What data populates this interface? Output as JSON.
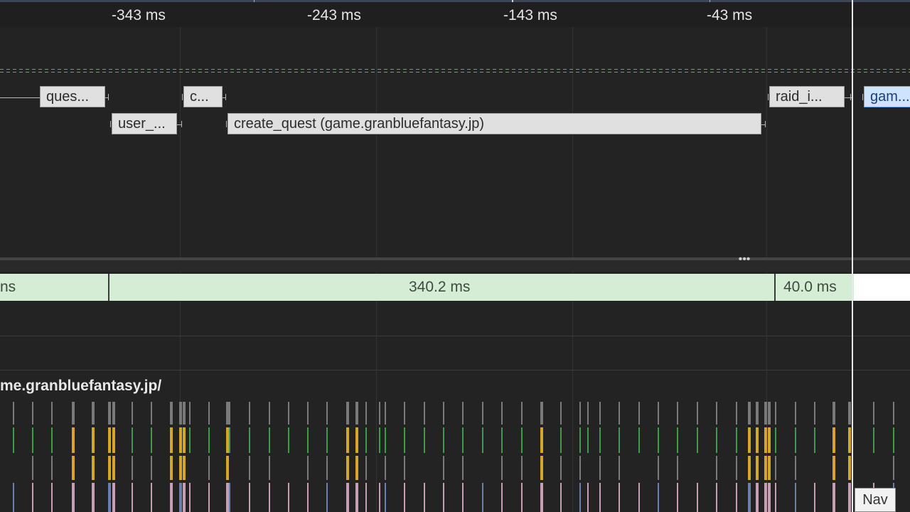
{
  "ruler": {
    "ticks": [
      "-343 ms",
      "-243 ms",
      "-143 ms",
      "-43 ms"
    ]
  },
  "network": {
    "requests": [
      {
        "label": "ques...",
        "selected": false
      },
      {
        "label": "user_...",
        "selected": false
      },
      {
        "label": "c...",
        "selected": false
      },
      {
        "label": "create_quest (game.granbluefantasy.jp)",
        "selected": false
      },
      {
        "label": "raid_i...",
        "selected": false
      },
      {
        "label": "gam...",
        "selected": true
      }
    ]
  },
  "frames": {
    "labels": [
      "ns",
      "340.2 ms",
      "40.0 ms"
    ]
  },
  "main": {
    "url": "me.granbluefantasy.jp/"
  },
  "nav_marker": {
    "label": "Nav"
  },
  "colors": {
    "background": "#232323",
    "frame_fill": "#d4edd4",
    "request_fill": "#e0e0e0",
    "selected_request_fill": "#cfe3ff",
    "network_dash": "#b06ad8",
    "scripting": "#d6a62a",
    "rendering": "#c79fb4",
    "painting": "#3f9a4a",
    "other": "#7a7a7a",
    "loading": "#6a7fb0"
  }
}
